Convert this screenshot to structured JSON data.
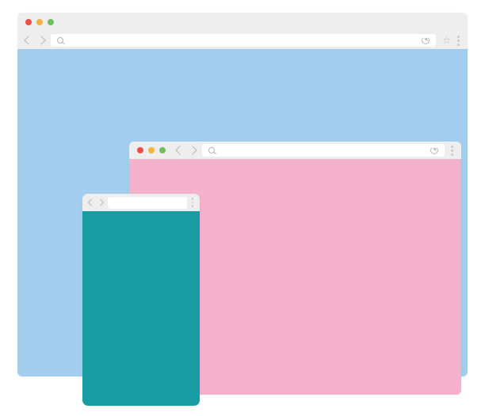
{
  "windows": {
    "large": {
      "viewport_color": "#a3cdee",
      "traffic": {
        "close": "#ea504a",
        "min": "#f4b23f",
        "max": "#6ebd5f"
      },
      "address_value": ""
    },
    "medium": {
      "viewport_color": "#f3b1cb",
      "traffic": {
        "close": "#ea504a",
        "min": "#f4b23f",
        "max": "#6ebd5f"
      },
      "address_value": ""
    },
    "small": {
      "viewport_color": "#179ca3",
      "address_value": ""
    }
  }
}
